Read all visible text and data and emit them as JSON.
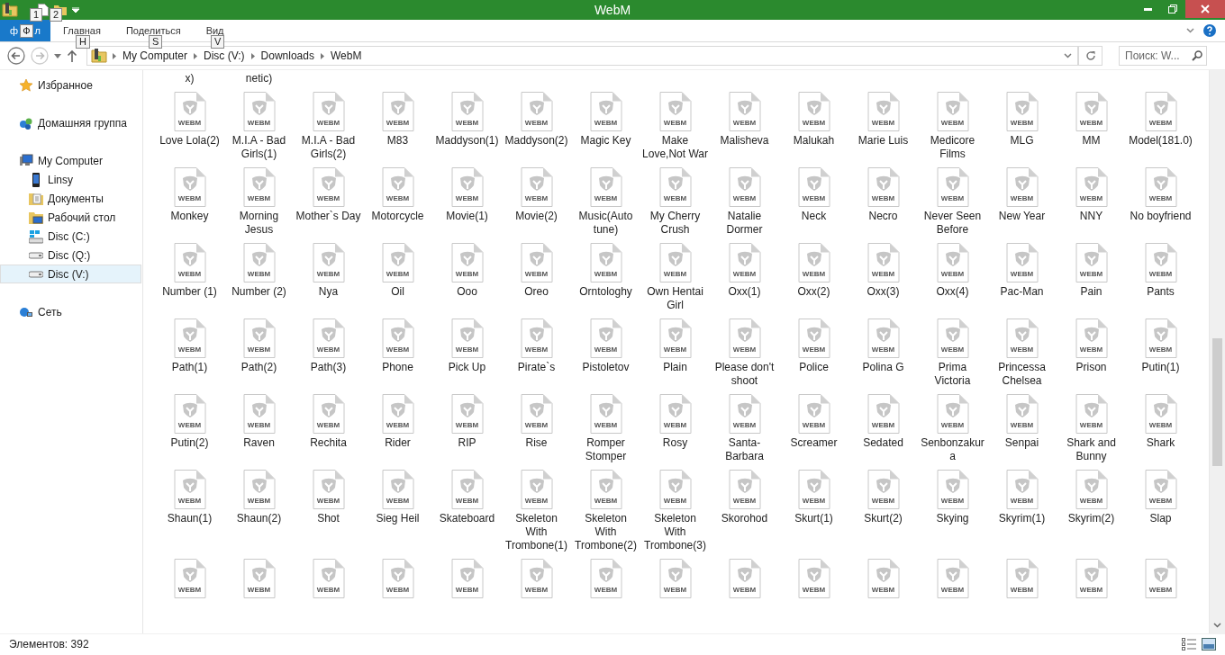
{
  "window": {
    "title": "WebM"
  },
  "quick_access_keytips": [
    "1",
    "2"
  ],
  "ribbon": {
    "tabs": [
      {
        "kind": "file",
        "label_before": "ф",
        "keytip": "Ф",
        "label_after": "л",
        "selected": false
      },
      {
        "kind": "tab",
        "label": "Главная",
        "keytip": "H",
        "selected": false
      },
      {
        "kind": "tab",
        "label": "Поделиться",
        "keytip": "S",
        "selected": false
      },
      {
        "kind": "tab",
        "label": "Вид",
        "keytip": "V",
        "selected": false
      }
    ]
  },
  "address_bar": {
    "path": [
      "My Computer",
      "Disc (V:)",
      "Downloads",
      "WebM"
    ]
  },
  "search": {
    "placeholder": "Поиск: W..."
  },
  "sidebar": {
    "items": [
      {
        "kind": "favorites",
        "label": "Избранное",
        "selected": false
      },
      {
        "kind": "homegroup",
        "label": "Домашняя группа",
        "selected": false
      },
      {
        "kind": "computer",
        "label": "My Computer",
        "selected": false,
        "children": [
          {
            "kind": "phone",
            "label": "Linsy",
            "selected": false
          },
          {
            "kind": "documents",
            "label": "Документы",
            "selected": false
          },
          {
            "kind": "desktop",
            "label": "Рабочий стол",
            "selected": false
          },
          {
            "kind": "system-drive",
            "label": "Disc (C:)",
            "selected": false
          },
          {
            "kind": "drive",
            "label": "Disc (Q:)",
            "selected": false
          },
          {
            "kind": "drive",
            "label": "Disc (V:)",
            "selected": true
          }
        ]
      },
      {
        "kind": "network",
        "label": "Сеть",
        "selected": false
      }
    ]
  },
  "files": [
    [
      {
        "name": "x)"
      },
      {
        "name": "netic)"
      }
    ],
    [
      {
        "name": "Love Lola(2)",
        "type": "WEBM"
      },
      {
        "name": "M.I.A - Bad Girls(1)",
        "type": "WEBM"
      },
      {
        "name": "M.I.A - Bad Girls(2)",
        "type": "WEBM"
      },
      {
        "name": "M83",
        "type": "WEBM"
      },
      {
        "name": "Maddyson(1)",
        "type": "WEBM"
      },
      {
        "name": "Maddyson(2)",
        "type": "WEBM"
      },
      {
        "name": "Magic Key",
        "type": "WEBM"
      },
      {
        "name": "Make Love,Not War",
        "type": "WEBM"
      },
      {
        "name": "Malisheva",
        "type": "WEBM"
      },
      {
        "name": "Malukah",
        "type": "WEBM"
      },
      {
        "name": "Marie Luis",
        "type": "WEBM"
      },
      {
        "name": "Medicore Films",
        "type": "WEBM"
      },
      {
        "name": "MLG",
        "type": "WEBM"
      },
      {
        "name": "MM",
        "type": "WEBM"
      },
      {
        "name": "Model(181.0)",
        "type": "WEBM"
      }
    ],
    [
      {
        "name": "Monkey",
        "type": "WEBM"
      },
      {
        "name": "Morning Jesus",
        "type": "WEBM"
      },
      {
        "name": "Mother`s Day",
        "type": "WEBM"
      },
      {
        "name": "Motorcycle",
        "type": "WEBM"
      },
      {
        "name": "Movie(1)",
        "type": "WEBM"
      },
      {
        "name": "Movie(2)",
        "type": "WEBM"
      },
      {
        "name": "Music(Auto tune)",
        "type": "WEBM"
      },
      {
        "name": "My Cherry Crush",
        "type": "WEBM"
      },
      {
        "name": "Natalie Dormer",
        "type": "WEBM"
      },
      {
        "name": "Neck",
        "type": "WEBM"
      },
      {
        "name": "Necro",
        "type": "WEBM"
      },
      {
        "name": "Never Seen Before",
        "type": "WEBM"
      },
      {
        "name": "New Year",
        "type": "WEBM"
      },
      {
        "name": "NNY",
        "type": "WEBM"
      },
      {
        "name": "No boyfriend",
        "type": "WEBM"
      }
    ],
    [
      {
        "name": "Number (1)",
        "type": "WEBM"
      },
      {
        "name": "Number (2)",
        "type": "WEBM"
      },
      {
        "name": "Nya",
        "type": "WEBM"
      },
      {
        "name": "Oil",
        "type": "WEBM"
      },
      {
        "name": "Ooo",
        "type": "WEBM"
      },
      {
        "name": "Oreo",
        "type": "WEBM"
      },
      {
        "name": "Orntologhy",
        "type": "WEBM"
      },
      {
        "name": "Own Hentai Girl",
        "type": "WEBM"
      },
      {
        "name": "Oxx(1)",
        "type": "WEBM"
      },
      {
        "name": "Oxx(2)",
        "type": "WEBM"
      },
      {
        "name": "Oxx(3)",
        "type": "WEBM"
      },
      {
        "name": "Oxx(4)",
        "type": "WEBM"
      },
      {
        "name": "Pac-Man",
        "type": "WEBM"
      },
      {
        "name": "Pain",
        "type": "WEBM"
      },
      {
        "name": "Pants",
        "type": "WEBM"
      }
    ],
    [
      {
        "name": "Path(1)",
        "type": "WEBM"
      },
      {
        "name": "Path(2)",
        "type": "WEBM"
      },
      {
        "name": "Path(3)",
        "type": "WEBM"
      },
      {
        "name": "Phone",
        "type": "WEBM"
      },
      {
        "name": "Pick Up",
        "type": "WEBM"
      },
      {
        "name": "Pirate`s",
        "type": "WEBM"
      },
      {
        "name": "Pistoletov",
        "type": "WEBM"
      },
      {
        "name": "Plain",
        "type": "WEBM"
      },
      {
        "name": "Please don't shoot",
        "type": "WEBM"
      },
      {
        "name": "Police",
        "type": "WEBM"
      },
      {
        "name": "Polina G",
        "type": "WEBM"
      },
      {
        "name": "Prima Victoria",
        "type": "WEBM"
      },
      {
        "name": "Princessa Chelsea",
        "type": "WEBM"
      },
      {
        "name": "Prison",
        "type": "WEBM"
      },
      {
        "name": "Putin(1)",
        "type": "WEBM"
      }
    ],
    [
      {
        "name": "Putin(2)",
        "type": "WEBM"
      },
      {
        "name": "Raven",
        "type": "WEBM"
      },
      {
        "name": "Rechita",
        "type": "WEBM"
      },
      {
        "name": "Rider",
        "type": "WEBM"
      },
      {
        "name": "RIP",
        "type": "WEBM"
      },
      {
        "name": "Rise",
        "type": "WEBM"
      },
      {
        "name": "Romper Stomper",
        "type": "WEBM"
      },
      {
        "name": "Rosy",
        "type": "WEBM"
      },
      {
        "name": "Santa-Barbara",
        "type": "WEBM"
      },
      {
        "name": "Screamer",
        "type": "WEBM"
      },
      {
        "name": "Sedated",
        "type": "WEBM"
      },
      {
        "name": "Senbonzakura",
        "type": "WEBM"
      },
      {
        "name": "Senpai",
        "type": "WEBM"
      },
      {
        "name": "Shark and Bunny",
        "type": "WEBM"
      },
      {
        "name": "Shark",
        "type": "WEBM"
      }
    ],
    [
      {
        "name": "Shaun(1)",
        "type": "WEBM"
      },
      {
        "name": "Shaun(2)",
        "type": "WEBM"
      },
      {
        "name": "Shot",
        "type": "WEBM"
      },
      {
        "name": "Sieg Heil",
        "type": "WEBM"
      },
      {
        "name": "Skateboard",
        "type": "WEBM"
      },
      {
        "name": "Skeleton With Trombone(1)",
        "type": "WEBM"
      },
      {
        "name": "Skeleton With Trombone(2)",
        "type": "WEBM"
      },
      {
        "name": "Skeleton With Trombone(3)",
        "type": "WEBM"
      },
      {
        "name": "Skorohod",
        "type": "WEBM"
      },
      {
        "name": "Skurt(1)",
        "type": "WEBM"
      },
      {
        "name": "Skurt(2)",
        "type": "WEBM"
      },
      {
        "name": "Skying",
        "type": "WEBM"
      },
      {
        "name": "Skyrim(1)",
        "type": "WEBM"
      },
      {
        "name": "Skyrim(2)",
        "type": "WEBM"
      },
      {
        "name": "Slap",
        "type": "WEBM"
      }
    ],
    [
      {
        "type": "WEBM"
      },
      {
        "type": "WEBM"
      },
      {
        "type": "WEBM"
      },
      {
        "type": "WEBM"
      },
      {
        "type": "WEBM"
      },
      {
        "type": "WEBM"
      },
      {
        "type": "WEBM"
      },
      {
        "type": "WEBM"
      },
      {
        "type": "WEBM"
      },
      {
        "type": "WEBM"
      },
      {
        "type": "WEBM"
      },
      {
        "type": "WEBM"
      },
      {
        "type": "WEBM"
      },
      {
        "type": "WEBM"
      },
      {
        "type": "WEBM"
      }
    ]
  ],
  "status_bar": {
    "item_count": "Элементов: 392"
  }
}
